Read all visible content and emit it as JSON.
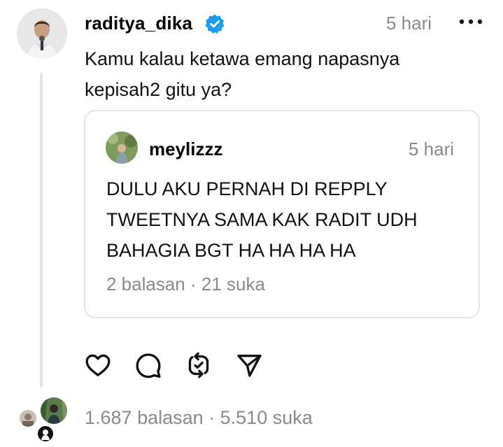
{
  "post": {
    "username": "raditya_dika",
    "time": "5 hari",
    "text_line1": "Kamu kalau ketawa emang napasnya",
    "text_line2": "kepisah2 gitu ya?",
    "stats": "1.687 balasan · 5.510 suka"
  },
  "quote": {
    "username": "meylizzz",
    "time": "5 hari",
    "text_line1": "DULU AKU PERNAH DI REPPLY",
    "text_line2": "TWEETNYA SAMA KAK RADIT UDH",
    "text_line3": "BAHAGIA BGT HA HA HA HA",
    "stats": "2 balasan · 21 suka"
  },
  "colors": {
    "verified": "#1d9bf0",
    "muted": "#8a8a8a",
    "divider": "#e5e5e5"
  },
  "icons": {
    "verified": "verified-badge-icon",
    "more": "more-options-icon",
    "like": "heart-icon",
    "reply": "comment-icon",
    "repost": "repost-icon",
    "share": "send-icon"
  }
}
